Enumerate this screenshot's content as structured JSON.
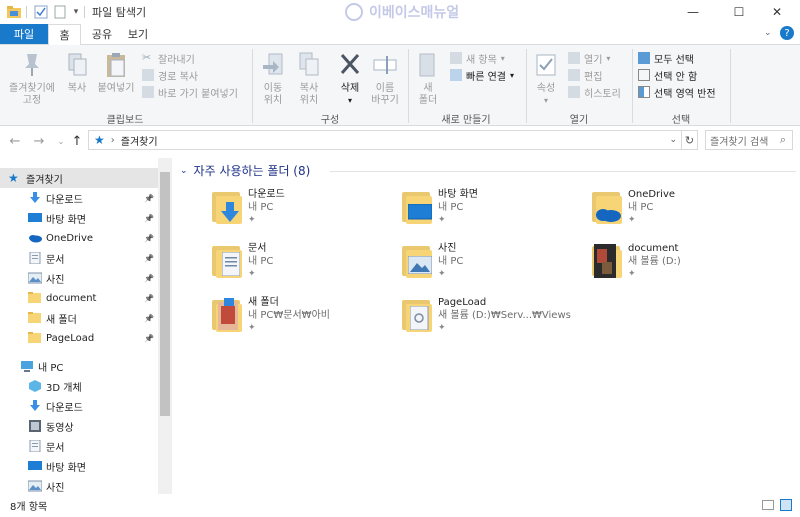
{
  "window": {
    "title": "파일 탐색기",
    "watermark": "이베이스매뉴얼",
    "minimize_glyph": "—",
    "maximize_glyph": "☐",
    "close_glyph": "✕"
  },
  "ribbon_tabs": [
    "파일",
    "홈",
    "공유",
    "보기"
  ],
  "ribbon": {
    "clipboard": {
      "pin_quick": "즐겨찾기에\n고정",
      "copy": "복사",
      "paste": "붙여넣기",
      "cut": "잘라내기",
      "copy_path": "경로 복사",
      "paste_shortcut": "바로 가기 붙여넣기",
      "label": "클립보드"
    },
    "organize": {
      "move_to": "이동\n위치",
      "copy_to": "복사\n위치",
      "delete": "삭제",
      "rename": "이름\n바꾸기",
      "label": "구성"
    },
    "new": {
      "new_folder": "새\n폴더",
      "new_item": "새 항목",
      "easy_access": "빠른 연결",
      "label": "새로 만들기"
    },
    "open": {
      "properties": "속성",
      "open": "열기",
      "edit": "편집",
      "history": "히스토리",
      "label": "열기"
    },
    "select": {
      "select_all": "모두 선택",
      "select_none": "선택 안 함",
      "invert": "선택 영역 반전",
      "label": "선택"
    }
  },
  "address": {
    "path": "즐겨찾기",
    "search_placeholder": "즐겨찾기 검색"
  },
  "nav": {
    "quick_access": "즐겨찾기",
    "quick_items": [
      {
        "label": "다운로드",
        "icon": "download-icon"
      },
      {
        "label": "바탕 화면",
        "icon": "desktop-icon"
      },
      {
        "label": "OneDrive",
        "icon": "onedrive-icon"
      },
      {
        "label": "문서",
        "icon": "documents-icon"
      },
      {
        "label": "사진",
        "icon": "pictures-icon"
      },
      {
        "label": "document",
        "icon": "folder-icon"
      },
      {
        "label": "새 폴더",
        "icon": "folder-icon"
      },
      {
        "label": "PageLoad",
        "icon": "folder-icon"
      }
    ],
    "this_pc": "내 PC",
    "pc_items": [
      {
        "label": "3D 개체",
        "icon": "3d-objects-icon"
      },
      {
        "label": "다운로드",
        "icon": "download-icon"
      },
      {
        "label": "동영상",
        "icon": "videos-icon"
      },
      {
        "label": "문서",
        "icon": "documents-icon"
      },
      {
        "label": "바탕 화면",
        "icon": "desktop-icon"
      },
      {
        "label": "사진",
        "icon": "pictures-icon"
      }
    ]
  },
  "content": {
    "section_title": "자주 사용하는 폴더 (8)",
    "folders": [
      {
        "name": "다운로드",
        "location": "내 PC",
        "overlay": "download"
      },
      {
        "name": "바탕 화면",
        "location": "내 PC",
        "overlay": "desktop"
      },
      {
        "name": "OneDrive",
        "location": "내 PC",
        "overlay": "cloud"
      },
      {
        "name": "문서",
        "location": "내 PC",
        "overlay": "doc"
      },
      {
        "name": "사진",
        "location": "내 PC",
        "overlay": "photo"
      },
      {
        "name": "document",
        "location": "새 볼륨 (D:)",
        "overlay": "dark"
      },
      {
        "name": "새 폴더",
        "location": "내 PC₩문서₩아비",
        "overlay": "image"
      },
      {
        "name": "PageLoad",
        "location": "새 볼륨 (D:)₩Serv...₩Views",
        "overlay": "file"
      }
    ]
  },
  "status": {
    "item_count": "8개 항목"
  },
  "colors": {
    "accent": "#1979ca",
    "folder": "#f7d577",
    "title_blue": "#1e3287"
  }
}
